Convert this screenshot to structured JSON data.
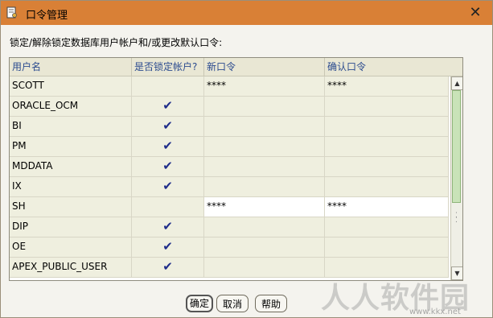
{
  "window": {
    "title": "口令管理",
    "icon": "key-doc-icon",
    "close_label": "✕"
  },
  "instruction": "锁定/解除锁定数据库用户帐户和/或更改默认口令:",
  "table": {
    "columns": [
      "用户名",
      "是否锁定帐户?",
      "新口令",
      "确认口令"
    ],
    "rows": [
      {
        "user": "SCOTT",
        "locked": false,
        "new_password": "****",
        "confirm_password": "****"
      },
      {
        "user": "ORACLE_OCM",
        "locked": true,
        "new_password": "",
        "confirm_password": ""
      },
      {
        "user": "BI",
        "locked": true,
        "new_password": "",
        "confirm_password": ""
      },
      {
        "user": "PM",
        "locked": true,
        "new_password": "",
        "confirm_password": ""
      },
      {
        "user": "MDDATA",
        "locked": true,
        "new_password": "",
        "confirm_password": ""
      },
      {
        "user": "IX",
        "locked": true,
        "new_password": "",
        "confirm_password": ""
      },
      {
        "user": "SH",
        "locked": false,
        "new_password": "****",
        "confirm_password": "****",
        "active": true
      },
      {
        "user": "DIP",
        "locked": true,
        "new_password": "",
        "confirm_password": ""
      },
      {
        "user": "OE",
        "locked": true,
        "new_password": "",
        "confirm_password": ""
      },
      {
        "user": "APEX_PUBLIC_USER",
        "locked": true,
        "new_password": "",
        "confirm_password": ""
      }
    ],
    "check_glyph": "✔"
  },
  "buttons": {
    "ok": "确定",
    "cancel": "取消",
    "help": "帮助"
  },
  "watermark": {
    "text": "人人软件园",
    "url": "www.kkx.net"
  },
  "colors": {
    "titlebar": "#d98036",
    "header_text": "#2b4b8f",
    "check": "#1f2d8a"
  }
}
